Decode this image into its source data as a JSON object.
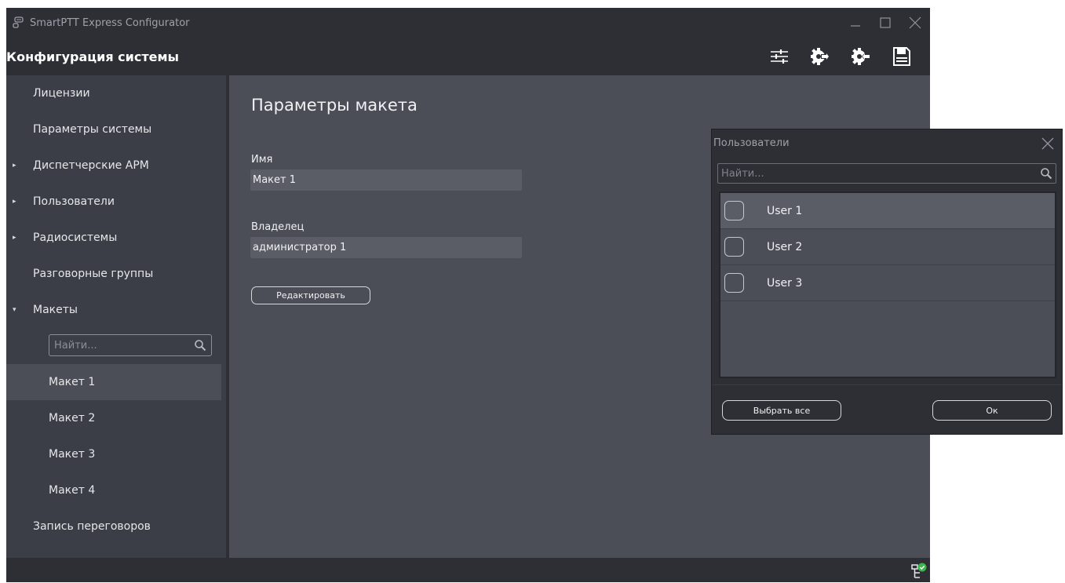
{
  "window": {
    "title": "SmartPTT Express Configurator",
    "header_title": "Конфигурация системы"
  },
  "toolbar": {
    "icons": [
      "settings-sliders-icon",
      "export-gear-icon",
      "import-gear-icon",
      "save-icon"
    ]
  },
  "sidebar": {
    "items": [
      {
        "label": "Лицензии",
        "expandable": false
      },
      {
        "label": "Параметры системы",
        "expandable": false
      },
      {
        "label": "Диспетчерские АРМ",
        "expandable": true,
        "expanded": false
      },
      {
        "label": "Пользователи",
        "expandable": true,
        "expanded": false
      },
      {
        "label": "Радиосистемы",
        "expandable": true,
        "expanded": false
      },
      {
        "label": "Разговорные группы",
        "expandable": false
      },
      {
        "label": "Макеты",
        "expandable": true,
        "expanded": true
      }
    ],
    "search_placeholder": "Найти...",
    "layouts": [
      "Макет 1",
      "Макет 2",
      "Макет 3",
      "Макет 4"
    ],
    "selected_layout": "Макет 1",
    "last_item": "Запись переговоров"
  },
  "main": {
    "title": "Параметры макета",
    "name_label": "Имя",
    "name_value": "Макет 1",
    "owner_label": "Владелец",
    "owner_value": "администратор 1",
    "edit_button": "Редактировать"
  },
  "dialog": {
    "title": "Пользователи",
    "search_placeholder": "Найти...",
    "users": [
      {
        "name": "User 1",
        "checked": false
      },
      {
        "name": "User 2",
        "checked": false
      },
      {
        "name": "User 3",
        "checked": false
      }
    ],
    "select_all_button": "Выбрать все",
    "ok_button": "Ок"
  },
  "colors": {
    "titlebar_bg": "#2d2f35",
    "sidebar_bg": "#3b3e46",
    "content_bg": "#4b4e57",
    "status_ok": "#3cb44b"
  }
}
